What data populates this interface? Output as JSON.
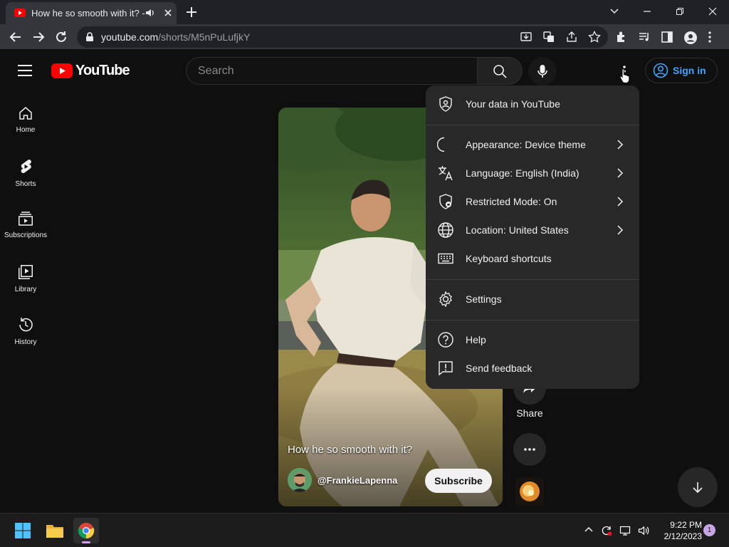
{
  "browser": {
    "tab_title": "How he so smooth with it? -",
    "url_host": "youtube.com",
    "url_path": "/shorts/M5nPuLufjkY"
  },
  "youtube": {
    "logo_text": "YouTube",
    "search_placeholder": "Search",
    "sign_in_label": "Sign in"
  },
  "sidebar": {
    "items": [
      {
        "label": "Home",
        "icon": "home-icon"
      },
      {
        "label": "Shorts",
        "icon": "shorts-icon"
      },
      {
        "label": "Subscriptions",
        "icon": "subscriptions-icon"
      },
      {
        "label": "Library",
        "icon": "library-icon"
      },
      {
        "label": "History",
        "icon": "history-icon"
      }
    ]
  },
  "video": {
    "title": "How he so smooth with it?",
    "channel": "@FrankieLapenna",
    "subscribe_label": "Subscribe",
    "share_label": "Share"
  },
  "menu": {
    "items": [
      {
        "label": "Your data in YouTube",
        "icon": "shield-person-icon",
        "submenu": false
      },
      {
        "label": "Appearance: Device theme",
        "icon": "moon-icon",
        "submenu": true
      },
      {
        "label": "Language: English (India)",
        "icon": "translate-icon",
        "submenu": true
      },
      {
        "label": "Restricted Mode: On",
        "icon": "restricted-shield-icon",
        "submenu": true
      },
      {
        "label": "Location: United States",
        "icon": "globe-icon",
        "submenu": true
      },
      {
        "label": "Keyboard shortcuts",
        "icon": "keyboard-icon",
        "submenu": false
      },
      {
        "label": "Settings",
        "icon": "gear-icon",
        "submenu": false
      },
      {
        "label": "Help",
        "icon": "help-icon",
        "submenu": false
      },
      {
        "label": "Send feedback",
        "icon": "feedback-icon",
        "submenu": false
      }
    ]
  },
  "taskbar": {
    "time": "9:22 PM",
    "date": "2/12/2023",
    "notification_count": "1"
  },
  "colors": {
    "youtube_red": "#ff0000",
    "link_blue": "#3ea6ff",
    "background": "#0f0f0f",
    "menu_bg": "#282828"
  }
}
